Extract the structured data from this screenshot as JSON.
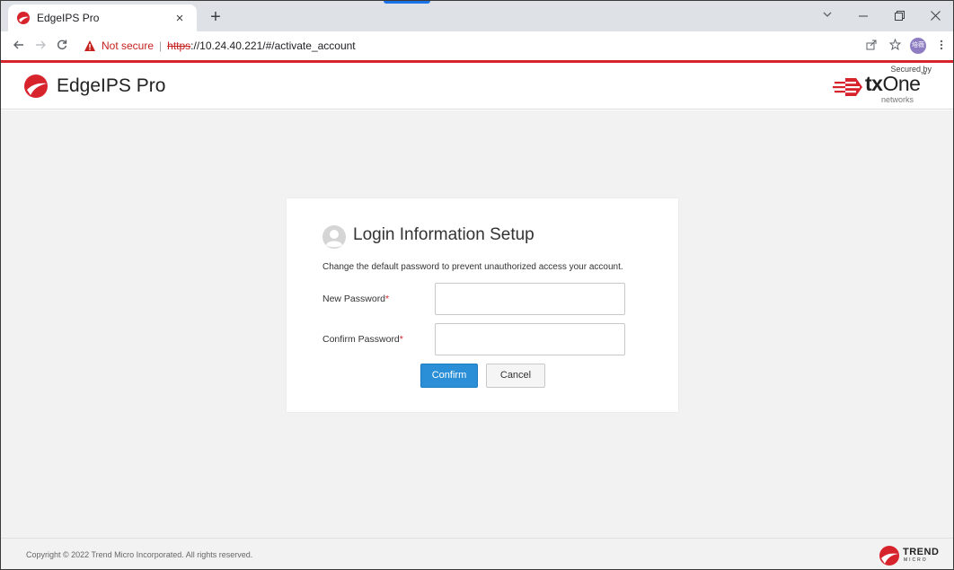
{
  "browser": {
    "tab_title": "EdgeIPS Pro",
    "tab_close": "×",
    "new_tab": "+",
    "security_label": "Not secure",
    "url_separator": "|",
    "url_scheme": "https",
    "url_rest": "://10.24.40.221/#/activate_account",
    "profile_initials": "培薇"
  },
  "header": {
    "product_name": "EdgeIPS Pro",
    "secured_by": "Secured by",
    "partner_bold": "tx",
    "partner_rest": "One",
    "partner_tm": "™",
    "partner_sub": "networks"
  },
  "dialog": {
    "title": "Login Information Setup",
    "description": "Change the default password to prevent unauthorized access your account.",
    "new_password_label": "New Password",
    "confirm_password_label": "Confirm Password",
    "required_marker": "*",
    "new_password_value": "",
    "confirm_password_value": "",
    "confirm_button": "Confirm",
    "cancel_button": "Cancel"
  },
  "footer": {
    "copyright": "Copyright © 2022 Trend Micro Incorporated. All rights reserved.",
    "vendor_word": "TREND",
    "vendor_sub": "MICRO"
  },
  "colors": {
    "brand_red": "#d7242c",
    "primary_button": "#2a8fd6",
    "page_background": "#f2f2f2"
  }
}
